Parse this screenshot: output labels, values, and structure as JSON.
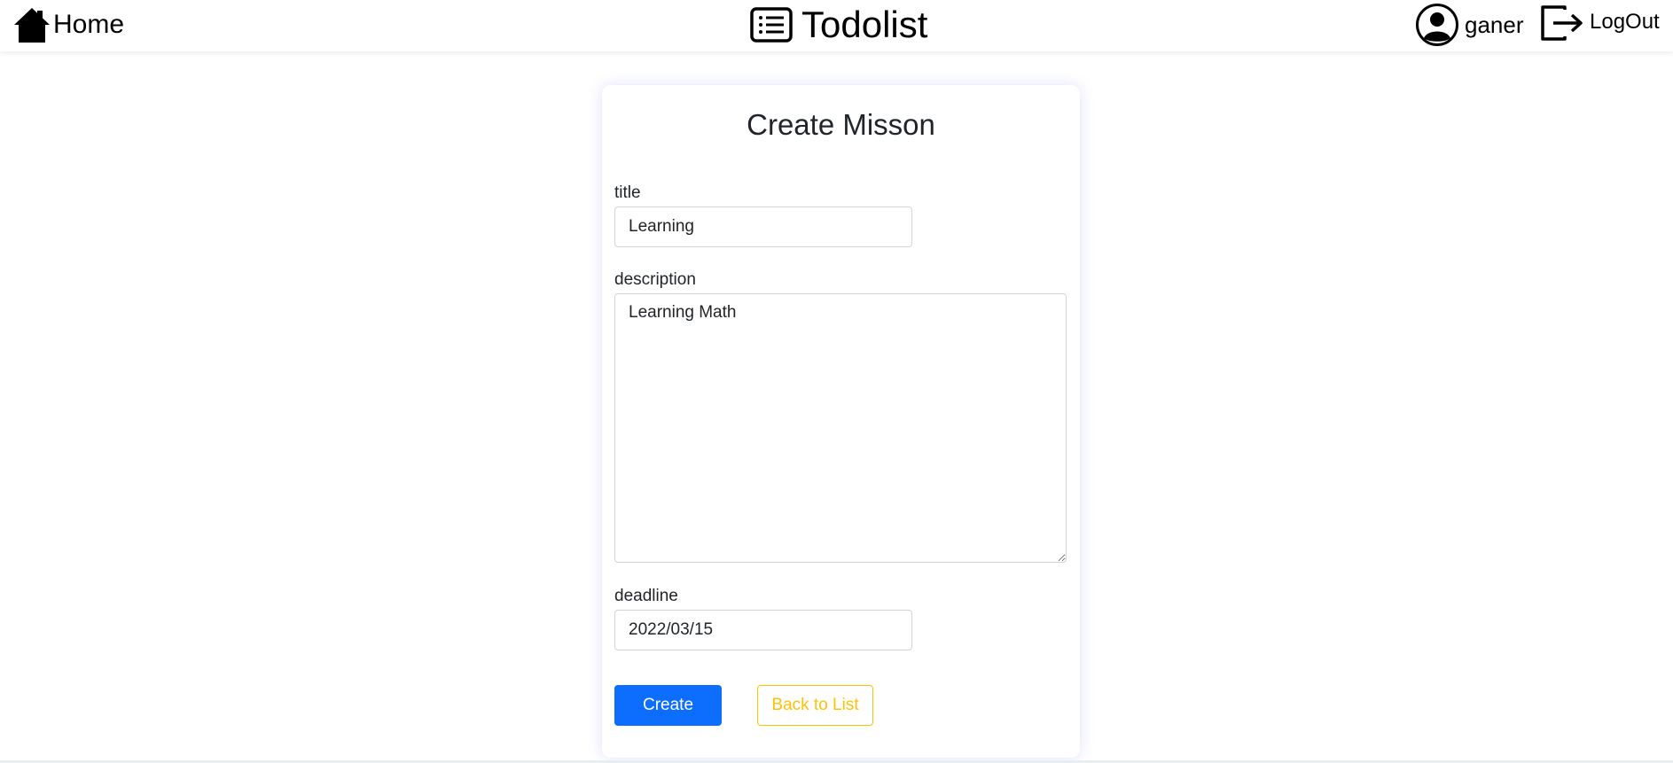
{
  "nav": {
    "home_label": "Home",
    "brand_label": "Todolist",
    "user_name": "ganer",
    "logout_label": "LogOut",
    "icons": {
      "home": "house-icon",
      "brand": "list-icon",
      "user": "person-circle-icon",
      "logout": "box-arrow-right-icon"
    }
  },
  "form": {
    "heading": "Create Misson",
    "title_label": "title",
    "title_value": "Learning",
    "description_label": "description",
    "description_value": "Learning Math",
    "deadline_label": "deadline",
    "deadline_value": "2022/03/15",
    "create_label": "Create",
    "back_label": "Back to List"
  },
  "colors": {
    "primary": "#0d6efd",
    "warning": "#ffc107",
    "text": "#212529",
    "border": "#ced4da"
  }
}
